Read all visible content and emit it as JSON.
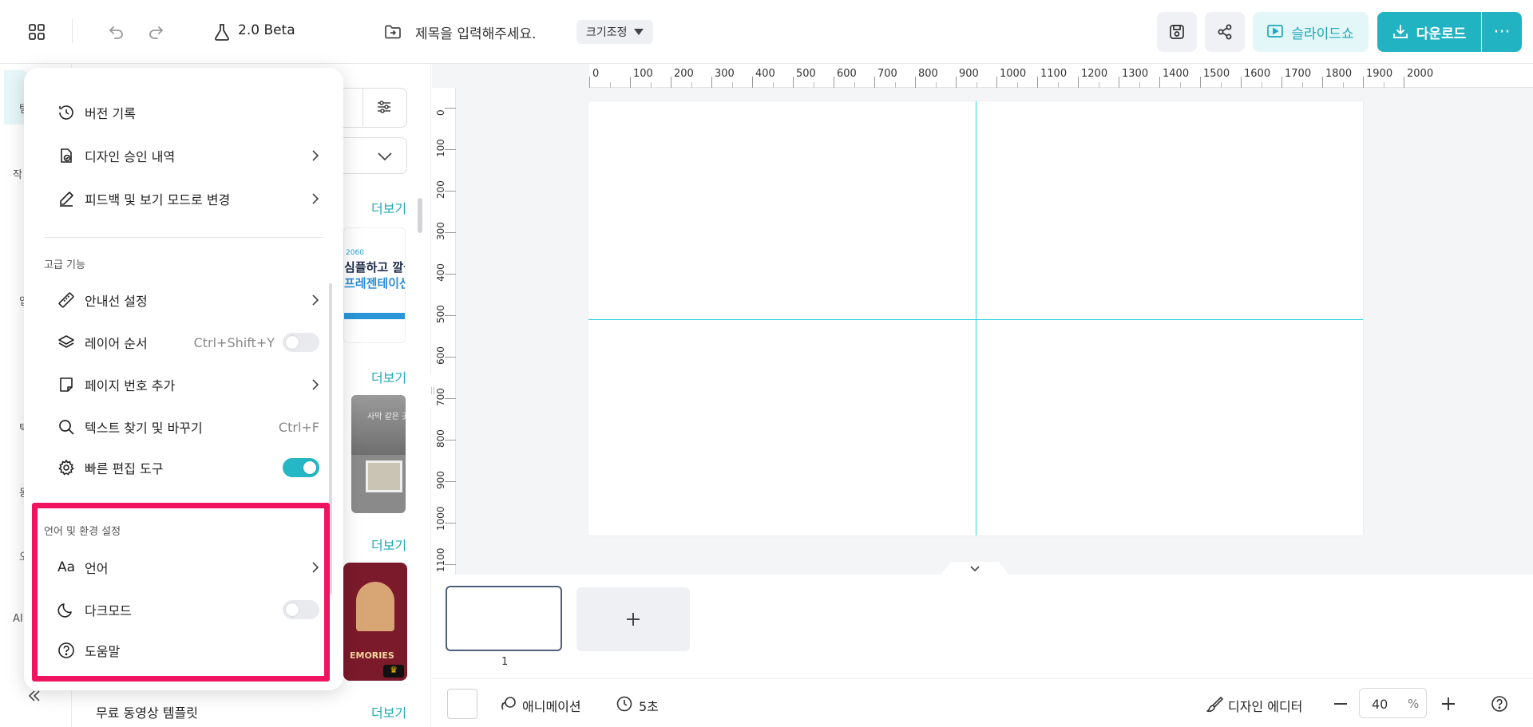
{
  "topbar": {
    "version": "2.0 Beta",
    "title_placeholder": "제목을 입력해주세요.",
    "resize_label": "크기조정",
    "slideshow_label": "슬라이드쇼",
    "download_label": "다운로드"
  },
  "rail": {
    "labels": [
      "탬",
      "작",
      "업",
      "텍",
      "동",
      "오",
      "AI"
    ]
  },
  "panel": {
    "more_label": "더보기",
    "section_free_video": "무료 동영상 템플릿",
    "thumb1_text_1": "심플하고 깔끔",
    "thumb1_text_2": "프레젠테이션",
    "thumb2_text": "사막 같은 곳",
    "thumb3_text": "EMORIES"
  },
  "menu": {
    "items_top": [
      {
        "label": "버전 기록",
        "icon": "history-icon"
      },
      {
        "label": "디자인 승인 내역",
        "icon": "approval-icon",
        "arrow": true
      },
      {
        "label": "피드백 및 보기 모드로 변경",
        "icon": "pen-icon",
        "arrow": true
      }
    ],
    "section_advanced": "고급 기능",
    "items_advanced": [
      {
        "label": "안내선 설정",
        "icon": "ruler-icon",
        "arrow": true
      },
      {
        "label": "레이어 순서",
        "icon": "layers-icon",
        "shortcut": "Ctrl+Shift+Y",
        "toggle": false
      },
      {
        "label": "페이지 번호 추가",
        "icon": "page-number-icon",
        "arrow": true
      },
      {
        "label": "텍스트 찾기 및 바꾸기",
        "icon": "search-icon",
        "shortcut": "Ctrl+F"
      },
      {
        "label": "빠른 편집 도구",
        "icon": "gear-icon",
        "toggle": true
      }
    ],
    "section_language": "언어 및 환경 설정",
    "items_language": [
      {
        "label": "언어",
        "icon": "text-aa-icon",
        "arrow": true
      },
      {
        "label": "다크모드",
        "icon": "moon-icon",
        "toggle": false
      },
      {
        "label": "도움말",
        "icon": "help-icon"
      }
    ]
  },
  "ruler": {
    "top": [
      "0",
      "100",
      "200",
      "300",
      "400",
      "500",
      "600",
      "700",
      "800",
      "900",
      "1000",
      "1100",
      "1200",
      "1300",
      "1400",
      "1500",
      "1600",
      "1700",
      "1800",
      "1900",
      "2000"
    ],
    "left": [
      "0",
      "100",
      "200",
      "300",
      "400",
      "500",
      "600",
      "700",
      "800",
      "900",
      "1000",
      "1100"
    ]
  },
  "pages": {
    "current_page": "1"
  },
  "bottombar": {
    "animation_label": "애니메이션",
    "duration_label": "5초",
    "design_editor_label": "디자인 에디터",
    "zoom_value": "40",
    "zoom_unit": "%"
  },
  "colors": {
    "accent": "#22b3c2",
    "highlight": "#f0135f",
    "guide": "#2fd4de"
  }
}
